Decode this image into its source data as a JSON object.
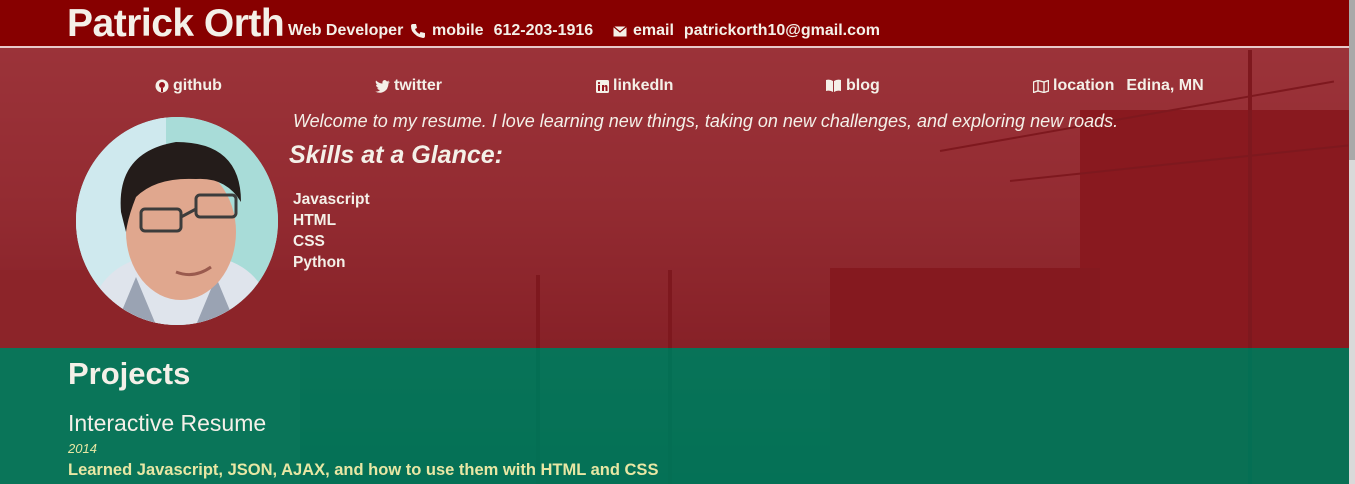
{
  "header": {
    "name": "Patrick Orth",
    "role": "Web Developer",
    "mobile_label": "mobile",
    "mobile_value": "612-203-1916",
    "email_label": "email",
    "email_value": "patrickorth10@gmail.com"
  },
  "links": [
    {
      "label": "github",
      "icon": "github-icon"
    },
    {
      "label": "twitter",
      "icon": "twitter-icon"
    },
    {
      "label": "linkedIn",
      "icon": "linkedin-icon"
    },
    {
      "label": "blog",
      "icon": "book-icon"
    },
    {
      "label": "location",
      "value": "Edina, MN",
      "icon": "map-icon"
    }
  ],
  "welcome": "Welcome to my resume. I love learning new things, taking on new challenges, and exploring new roads.",
  "skills_title": "Skills at a Glance:",
  "skills": [
    "Javascript",
    "HTML",
    "CSS",
    "Python"
  ],
  "projects": {
    "heading": "Projects",
    "items": [
      {
        "title": "Interactive Resume",
        "date": "2014",
        "description": "Learned Javascript, JSON, AJAX, and how to use them with HTML and CSS"
      }
    ]
  },
  "colors": {
    "header_bg": "#870000",
    "top_overlay": "#96141e",
    "projects_overlay": "#00785a",
    "accent_yellow": "#e8e7a4"
  }
}
